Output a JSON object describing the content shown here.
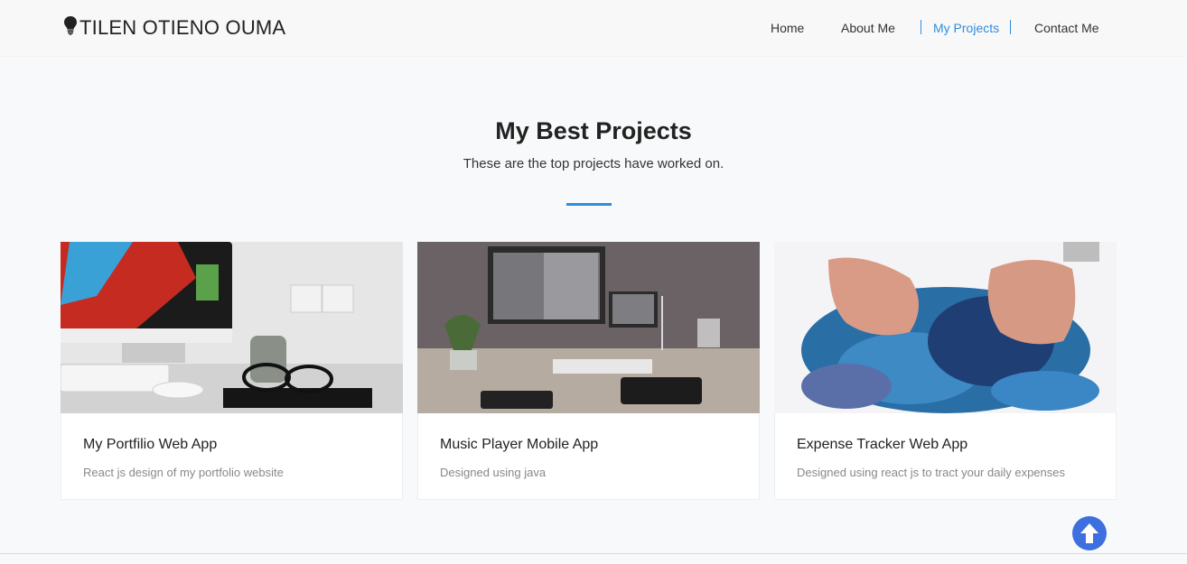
{
  "brand": {
    "name": "TILEN OTIENO OUMA",
    "icon": "lightbulb-icon"
  },
  "nav": {
    "items": [
      {
        "label": "Home"
      },
      {
        "label": "About Me"
      },
      {
        "label": "My Projects",
        "active": true
      },
      {
        "label": "Contact Me"
      }
    ]
  },
  "section": {
    "title": "My Best Projects",
    "subtitle": "These are the top projects have worked on."
  },
  "projects": [
    {
      "title": "My Portfilio Web App",
      "description": "React js design of my portfolio website",
      "image": "desk-imac-image"
    },
    {
      "title": "Music Player Mobile App",
      "description": "Designed using java",
      "image": "desk-monitors-image"
    },
    {
      "title": "Expense Tracker Web App",
      "description": "Designed using react js to tract your daily expenses",
      "image": "puzzle-hands-image"
    }
  ],
  "scroll_top": {
    "icon": "arrow-up-icon"
  },
  "colors": {
    "accent": "#2f8ddd",
    "scroll_button": "#3d6fdf"
  }
}
